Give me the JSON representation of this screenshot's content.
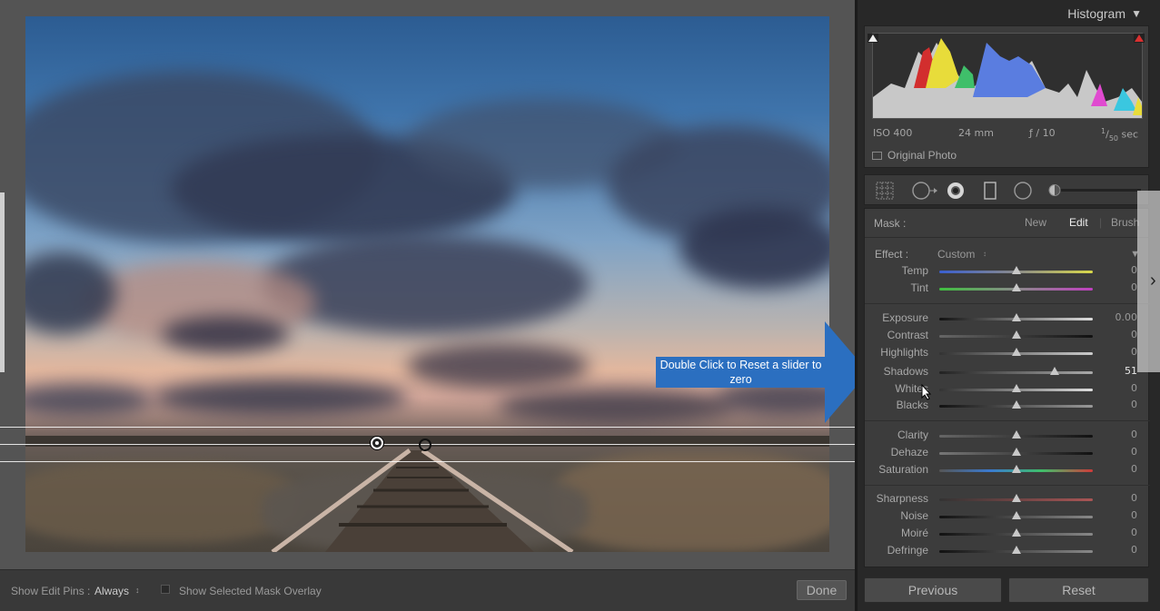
{
  "toolbar": {
    "show_edit_pins_label": "Show Edit Pins :",
    "show_edit_pins_value": "Always",
    "show_mask_overlay_label": "Show Selected Mask Overlay",
    "done_label": "Done"
  },
  "tooltip": {
    "text": "Double Click to Reset a slider to zero"
  },
  "histogram": {
    "title": "Histogram",
    "iso": "ISO 400",
    "focal_length": "24 mm",
    "aperture": "ƒ / 10",
    "shutter_num": "1",
    "shutter_den": "50",
    "shutter_unit": "sec",
    "original_photo_label": "Original Photo"
  },
  "mask": {
    "label": "Mask :",
    "new_label": "New",
    "edit_label": "Edit",
    "brush_label": "Brush"
  },
  "effect": {
    "label": "Effect :",
    "value": "Custom"
  },
  "sliders": {
    "temp": {
      "label": "Temp",
      "value": "0",
      "level": 0.5
    },
    "tint": {
      "label": "Tint",
      "value": "0",
      "level": 0.5
    },
    "exposure": {
      "label": "Exposure",
      "value": "0.00",
      "level": 0.5
    },
    "contrast": {
      "label": "Contrast",
      "value": "0",
      "level": 0.5
    },
    "highlights": {
      "label": "Highlights",
      "value": "0",
      "level": 0.5
    },
    "shadows": {
      "label": "Shadows",
      "value": "51",
      "level": 0.75
    },
    "whites": {
      "label": "Whites",
      "value": "0",
      "level": 0.5
    },
    "blacks": {
      "label": "Blacks",
      "value": "0",
      "level": 0.5
    },
    "clarity": {
      "label": "Clarity",
      "value": "0",
      "level": 0.5
    },
    "dehaze": {
      "label": "Dehaze",
      "value": "0",
      "level": 0.5
    },
    "saturation": {
      "label": "Saturation",
      "value": "0",
      "level": 0.5
    },
    "sharpness": {
      "label": "Sharpness",
      "value": "0",
      "level": 0.5
    },
    "noise": {
      "label": "Noise",
      "value": "0",
      "level": 0.5
    },
    "moire": {
      "label": "Moiré",
      "value": "0",
      "level": 0.5
    },
    "defringe": {
      "label": "Defringe",
      "value": "0",
      "level": 0.5
    }
  },
  "nav": {
    "previous_label": "Previous",
    "reset_label": "Reset"
  },
  "colors": {
    "tooltip_bg": "#2b6fc0",
    "temp_gradient": [
      "#3a5fd0",
      "#d8d84a"
    ],
    "tint_gradient": [
      "#3fbf3f",
      "#c040c0"
    ],
    "saturation_gradient": [
      "#3a7ad0",
      "#d03a3a"
    ]
  },
  "icons": {
    "graduated_filter": "grid-icon",
    "radial_filter": "radial-filter-icon",
    "spot_removal": "spot-icon",
    "crop": "crop-icon",
    "red_eye": "circle-icon",
    "amount_slider": "amount-slider-icon"
  }
}
